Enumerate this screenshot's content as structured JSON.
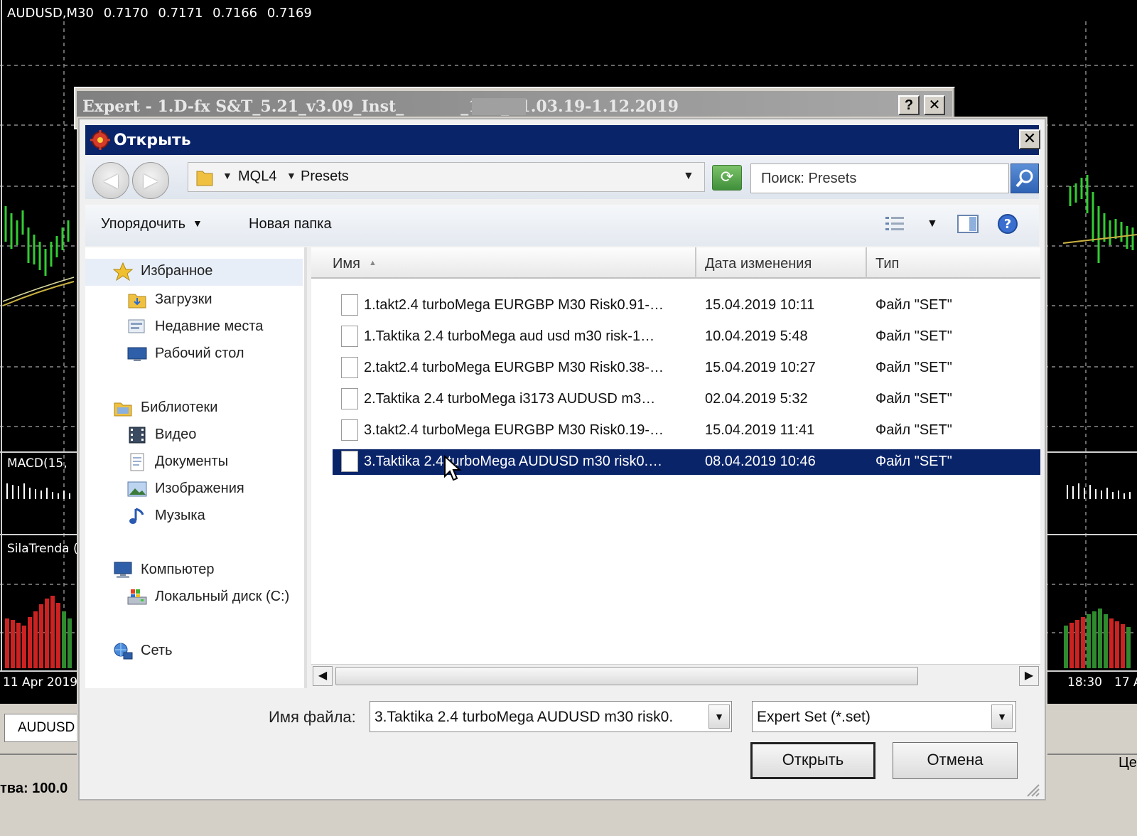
{
  "background": {
    "chart_header": {
      "symbol": "AUDUSD,M30",
      "quotes": [
        "0.7170",
        "0.7171",
        "0.7166",
        "0.7169"
      ]
    },
    "indicator_macd_label": "MACD(15,",
    "indicator_sila_label": "SilaTrenda (",
    "time_axis_left": "11 Apr 2019",
    "time_axis_right": [
      "18:30",
      "17 A"
    ],
    "symbol_tab_label": "AUDUSD",
    "status_left": "тва: 100.0",
    "status_right": "Це"
  },
  "expert_window": {
    "title_prefix": "Expert - 1.D-fx S&T_5.21_v3.09_Inst_",
    "title_suffix": "_177_21.03.19-1.12.2019",
    "help_button": "?",
    "close_button": "✕"
  },
  "dialog": {
    "title": "Открыть",
    "close_button": "✕",
    "back_button": "◀",
    "forward_button": "▶",
    "address": {
      "crumbs": [
        "MQL4",
        "Presets"
      ]
    },
    "search": {
      "placeholder": "Поиск: Presets"
    },
    "toolbar": {
      "organize_label": "Упорядочить",
      "new_folder_label": "Новая папка"
    },
    "nav_pane": {
      "favorites": {
        "label": "Избранное",
        "items": [
          "Загрузки",
          "Недавние места",
          "Рабочий стол"
        ]
      },
      "libraries": {
        "label": "Библиотеки",
        "items": [
          "Видео",
          "Документы",
          "Изображения",
          "Музыка"
        ]
      },
      "computer": {
        "label": "Компьютер",
        "items": [
          "Локальный диск (C:)"
        ]
      },
      "network": {
        "label": "Сеть"
      }
    },
    "file_list": {
      "columns": {
        "name": "Имя",
        "date": "Дата изменения",
        "type": "Тип"
      },
      "rows": [
        {
          "name": "1.takt2.4 turboMega EURGBP M30 Risk0.91-…",
          "date": "15.04.2019 10:11",
          "type": "Файл \"SET\""
        },
        {
          "name": "1.Taktika 2.4 turboMega aud usd m30 risk-1…",
          "date": "10.04.2019 5:48",
          "type": "Файл \"SET\""
        },
        {
          "name": "2.takt2.4 turboMega EURGBP M30 Risk0.38-…",
          "date": "15.04.2019 10:27",
          "type": "Файл \"SET\""
        },
        {
          "name": "2.Taktika 2.4 turboMega  i3173 AUDUSD m3…",
          "date": "02.04.2019 5:32",
          "type": "Файл \"SET\""
        },
        {
          "name": "3.takt2.4 turboMega EURGBP M30 Risk0.19-…",
          "date": "15.04.2019 11:41",
          "type": "Файл \"SET\""
        },
        {
          "name": "3.Taktika 2.4 turboMega AUDUSD m30 risk0.…",
          "date": "08.04.2019 10:46",
          "type": "Файл \"SET\""
        }
      ],
      "selected_row": 6
    },
    "scroll_left": "◀",
    "scroll_right": "▶",
    "file_name_label": "Имя файла:",
    "file_name_value": "3.Taktika 2.4 turboMega AUDUSD m30 risk0.",
    "file_type_value": "Expert Set (*.set)",
    "open_button": "Открыть",
    "cancel_button": "Отмена"
  }
}
